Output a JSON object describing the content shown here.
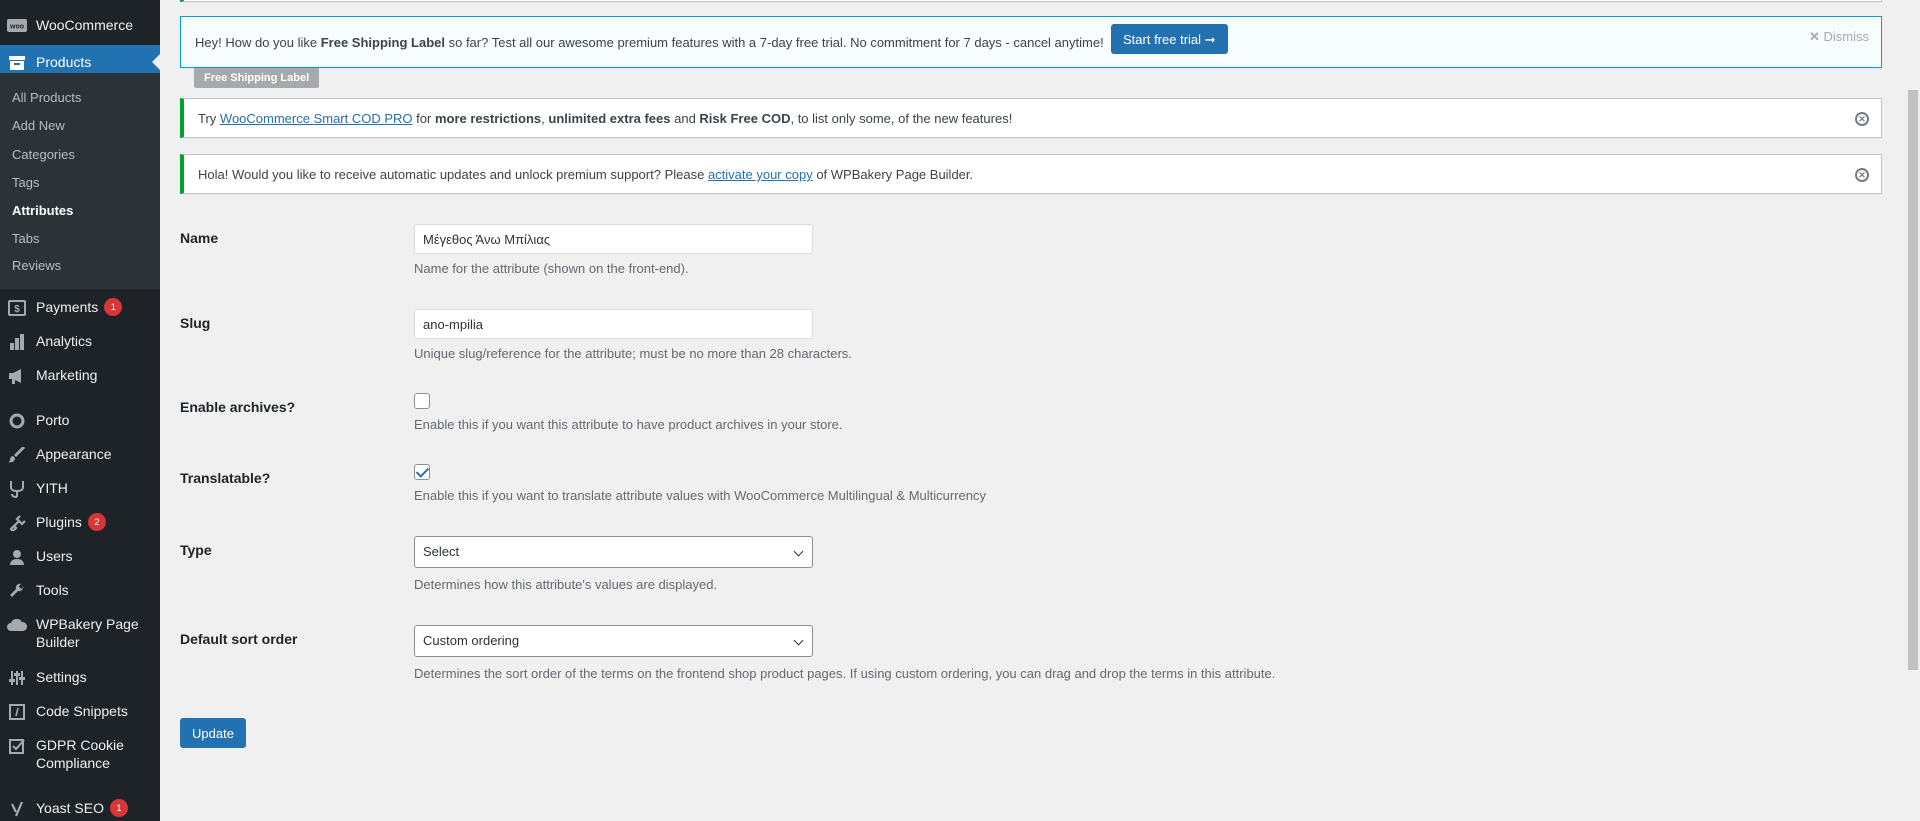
{
  "sidebar": {
    "woocommerce": "WooCommerce",
    "products": "Products",
    "submenu": [
      "All Products",
      "Add New",
      "Categories",
      "Tags",
      "Attributes",
      "Tabs",
      "Reviews"
    ],
    "payments": "Payments",
    "payments_badge": "1",
    "analytics": "Analytics",
    "marketing": "Marketing",
    "porto": "Porto",
    "appearance": "Appearance",
    "yith": "YITH",
    "plugins": "Plugins",
    "plugins_badge": "2",
    "users": "Users",
    "tools": "Tools",
    "wpbakery": "WPBakery Page Builder",
    "settings": "Settings",
    "code_snippets": "Code Snippets",
    "gdpr": "GDPR Cookie Compliance",
    "yoast": "Yoast SEO",
    "yoast_badge": "1"
  },
  "notices": {
    "promo_pre": "Hey! How do you like ",
    "promo_bold": "Free Shipping Label",
    "promo_post": " so far? Test all our awesome premium features with a 7-day free trial. No commitment for 7 days - cancel anytime!",
    "promo_button": "Start free trial ➞",
    "promo_dismiss": "Dismiss",
    "promo_tag": "Free Shipping Label",
    "cod_pre": "Try ",
    "cod_link": "WooCommerce Smart COD PRO",
    "cod_mid1": " for ",
    "cod_b1": "more restrictions",
    "cod_mid2": ", ",
    "cod_b2": "unlimited extra fees",
    "cod_mid3": " and ",
    "cod_b3": "Risk Free COD",
    "cod_post": ", to list only some, of the new features!",
    "wpb_pre": "Hola! Would you like to receive automatic updates and unlock premium support? Please ",
    "wpb_link": "activate your copy",
    "wpb_post": " of WPBakery Page Builder."
  },
  "form": {
    "name_label": "Name",
    "name_value": "Μέγεθος Άνω Μπίλιας",
    "name_desc": "Name for the attribute (shown on the front-end).",
    "slug_label": "Slug",
    "slug_value": "ano-mpilia",
    "slug_desc": "Unique slug/reference for the attribute; must be no more than 28 characters.",
    "archives_label": "Enable archives?",
    "archives_checked": false,
    "archives_desc": "Enable this if you want this attribute to have product archives in your store.",
    "translatable_label": "Translatable?",
    "translatable_checked": true,
    "translatable_desc": "Enable this if you want to translate attribute values with WooCommerce Multilingual & Multicurrency",
    "type_label": "Type",
    "type_value": "Select",
    "type_desc": "Determines how this attribute's values are displayed.",
    "sort_label": "Default sort order",
    "sort_value": "Custom ordering",
    "sort_desc": "Determines the sort order of the terms on the frontend shop product pages. If using custom ordering, you can drag and drop the terms in this attribute.",
    "update_button": "Update"
  }
}
